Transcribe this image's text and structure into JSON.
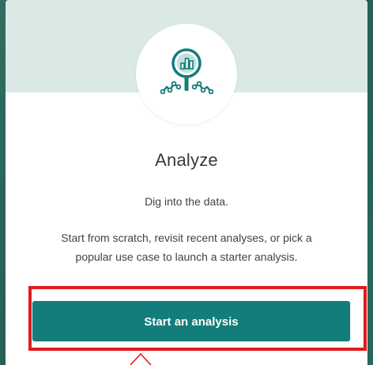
{
  "card": {
    "icon": "analyze-magnifier-chart-icon",
    "title": "Analyze",
    "subtitle": "Dig into the data.",
    "description_line1": "Start from scratch, revisit recent analyses, or pick a",
    "description_line2": "popular use case to launch a starter analysis.",
    "button_label": "Start an analysis"
  },
  "colors": {
    "accent": "#127d7a",
    "header_tint": "#dbe9e6",
    "highlight": "#e01b1b"
  }
}
